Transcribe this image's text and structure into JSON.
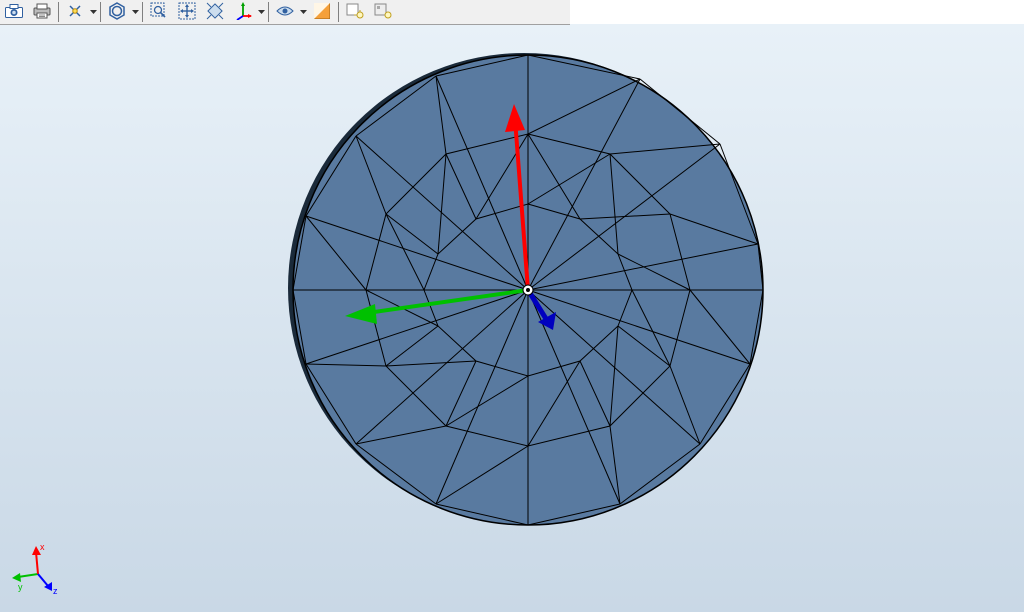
{
  "toolbar": {
    "items": [
      {
        "name": "screenshot-button",
        "icon": "camera-icon",
        "dropdown": false
      },
      {
        "name": "print-button",
        "icon": "printer-icon",
        "dropdown": false
      },
      {
        "sep": true
      },
      {
        "name": "datum-button",
        "icon": "datum-point-icon",
        "dropdown": true
      },
      {
        "sep": true
      },
      {
        "name": "render-style-button",
        "icon": "hexagon-icon",
        "dropdown": true
      },
      {
        "sep": true
      },
      {
        "name": "zoom-box-button",
        "icon": "zoom-box-icon",
        "dropdown": false
      },
      {
        "name": "pan-button",
        "icon": "pan-icon",
        "dropdown": false
      },
      {
        "name": "fit-button",
        "icon": "fit-view-icon",
        "dropdown": false
      },
      {
        "name": "orientation-button",
        "icon": "orientation-triad-icon",
        "dropdown": true
      },
      {
        "sep": true
      },
      {
        "name": "visibility-button",
        "icon": "eye-icon",
        "dropdown": true
      },
      {
        "name": "color-button",
        "icon": "color-swatch-icon",
        "dropdown": false
      },
      {
        "sep": true
      },
      {
        "name": "light-front-button",
        "icon": "light-front-icon",
        "dropdown": false
      },
      {
        "name": "light-panel-button",
        "icon": "light-panel-icon",
        "dropdown": false
      }
    ]
  },
  "viewport": {
    "background_top": "#e8f1f8",
    "background_bottom": "#c9d8e6",
    "mesh": {
      "shape": "disc",
      "color": "#597aa0",
      "edge_color": "#000000",
      "center": [
        528,
        290
      ],
      "radius": 235,
      "value_triad": {
        "x_axis_color": "#ff0000",
        "y_axis_color": "#00c000",
        "z_axis_color": "#0000bf"
      }
    },
    "orientation_triad": {
      "position": "bottom-left",
      "x_label": "x",
      "y_label": "y",
      "z_label": "z",
      "x_color": "#ff0000",
      "y_color": "#00c000",
      "z_color": "#0000ff"
    }
  }
}
